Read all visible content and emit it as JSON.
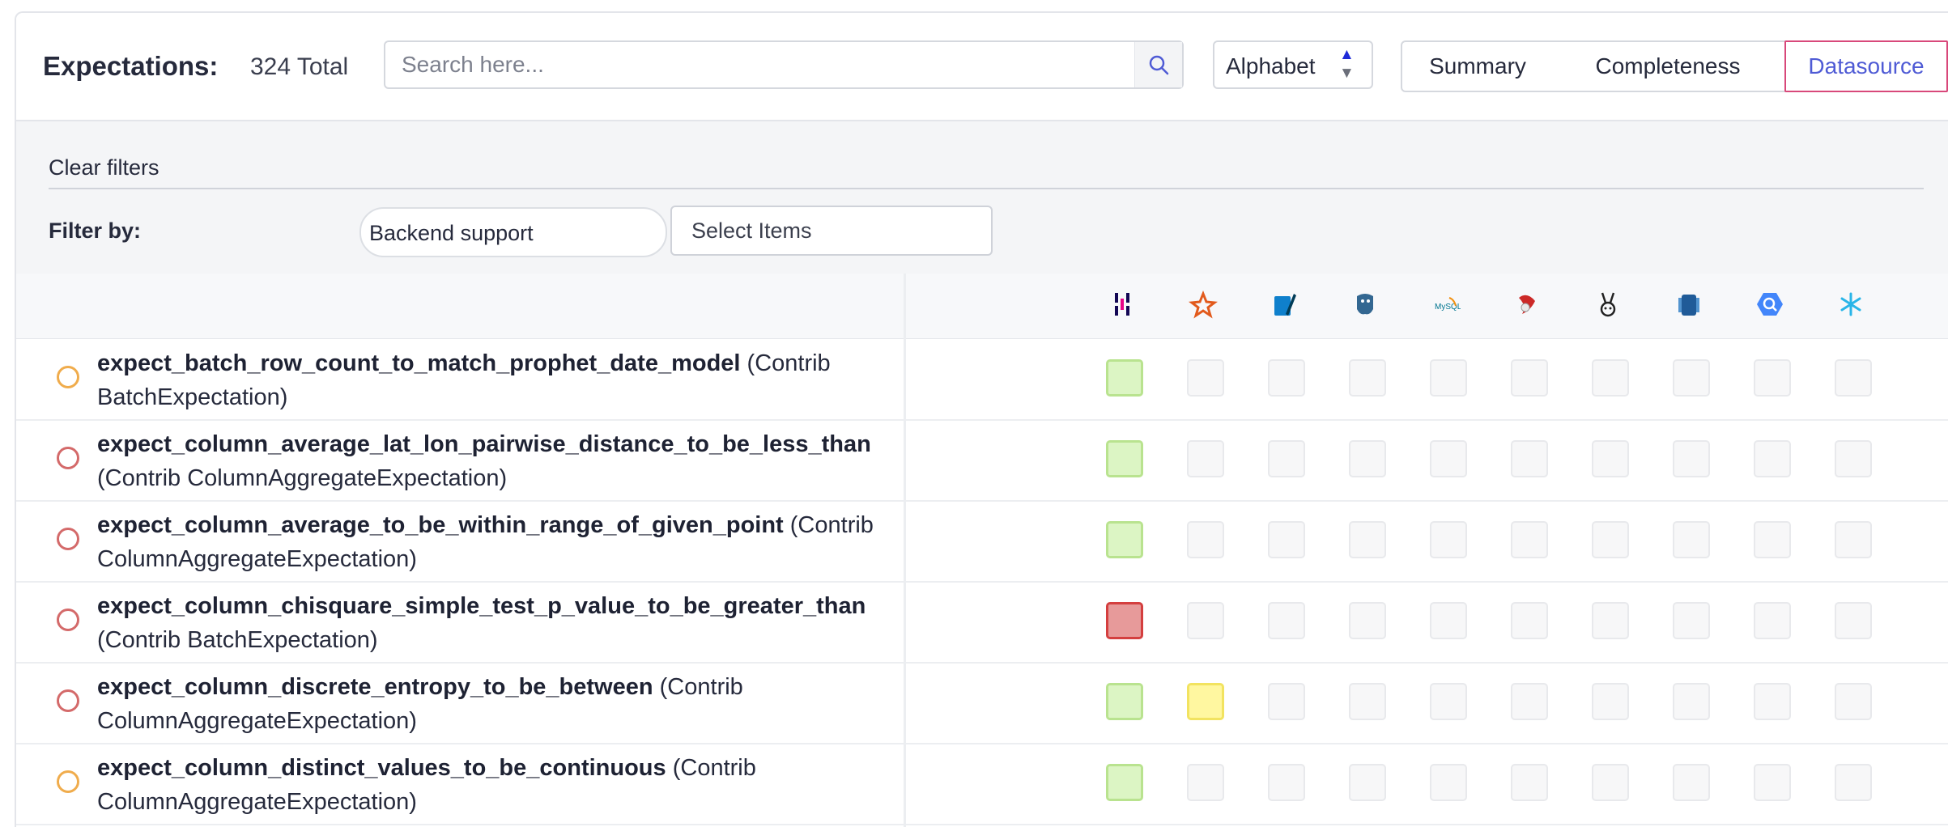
{
  "header": {
    "title": "Expectations:",
    "total": "324 Total",
    "search_placeholder": "Search here...",
    "sort_value": "Alphabet",
    "views": [
      {
        "label": "Summary",
        "active": false
      },
      {
        "label": "Completeness",
        "active": false
      },
      {
        "label": "Datasource",
        "active": true
      }
    ]
  },
  "filters": {
    "clear_label": "Clear filters",
    "filter_by_label": "Filter by:",
    "backend_label": "Backend support",
    "select_label": "Select Items"
  },
  "datasources": [
    {
      "name": "pandas-icon"
    },
    {
      "name": "spark-icon"
    },
    {
      "name": "sqlite-icon"
    },
    {
      "name": "postgresql-icon"
    },
    {
      "name": "mysql-icon"
    },
    {
      "name": "mssql-icon"
    },
    {
      "name": "trino-icon"
    },
    {
      "name": "redshift-icon"
    },
    {
      "name": "bigquery-icon"
    },
    {
      "name": "snowflake-icon"
    }
  ],
  "rows": [
    {
      "name": "expect_batch_row_count_to_match_prophet_date_model",
      "suffix_line1": " (Contrib",
      "line2": "BatchExpectation)",
      "status": "orange",
      "cells": [
        "green",
        "none",
        "none",
        "none",
        "none",
        "none",
        "none",
        "none",
        "none",
        "none"
      ]
    },
    {
      "name": "expect_column_average_lat_lon_pairwise_distance_to_be_less_than",
      "suffix_line1": "",
      "line2": "(Contrib ColumnAggregateExpectation)",
      "status": "red",
      "cells": [
        "green",
        "none",
        "none",
        "none",
        "none",
        "none",
        "none",
        "none",
        "none",
        "none"
      ]
    },
    {
      "name": "expect_column_average_to_be_within_range_of_given_point",
      "suffix_line1": " (Contrib",
      "line2": "ColumnAggregateExpectation)",
      "status": "red",
      "cells": [
        "green",
        "none",
        "none",
        "none",
        "none",
        "none",
        "none",
        "none",
        "none",
        "none"
      ]
    },
    {
      "name": "expect_column_chisquare_simple_test_p_value_to_be_greater_than",
      "suffix_line1": "",
      "line2": "(Contrib BatchExpectation)",
      "status": "red",
      "cells": [
        "red",
        "none",
        "none",
        "none",
        "none",
        "none",
        "none",
        "none",
        "none",
        "none"
      ]
    },
    {
      "name": "expect_column_discrete_entropy_to_be_between",
      "suffix_line1": " (Contrib",
      "line2": "ColumnAggregateExpectation)",
      "status": "red",
      "cells": [
        "green",
        "yellow",
        "none",
        "none",
        "none",
        "none",
        "none",
        "none",
        "none",
        "none"
      ]
    },
    {
      "name": "expect_column_distinct_values_to_be_continuous",
      "suffix_line1": " (Contrib",
      "line2": "ColumnAggregateExpectation)",
      "status": "orange",
      "cells": [
        "green",
        "none",
        "none",
        "none",
        "none",
        "none",
        "none",
        "none",
        "none",
        "none"
      ]
    }
  ],
  "colors": {
    "accent": "#4f5bd5",
    "active_border": "#d8487a",
    "supported": "#dcf5c4",
    "failed": "#e79a9a",
    "partial": "#fff7a0"
  }
}
